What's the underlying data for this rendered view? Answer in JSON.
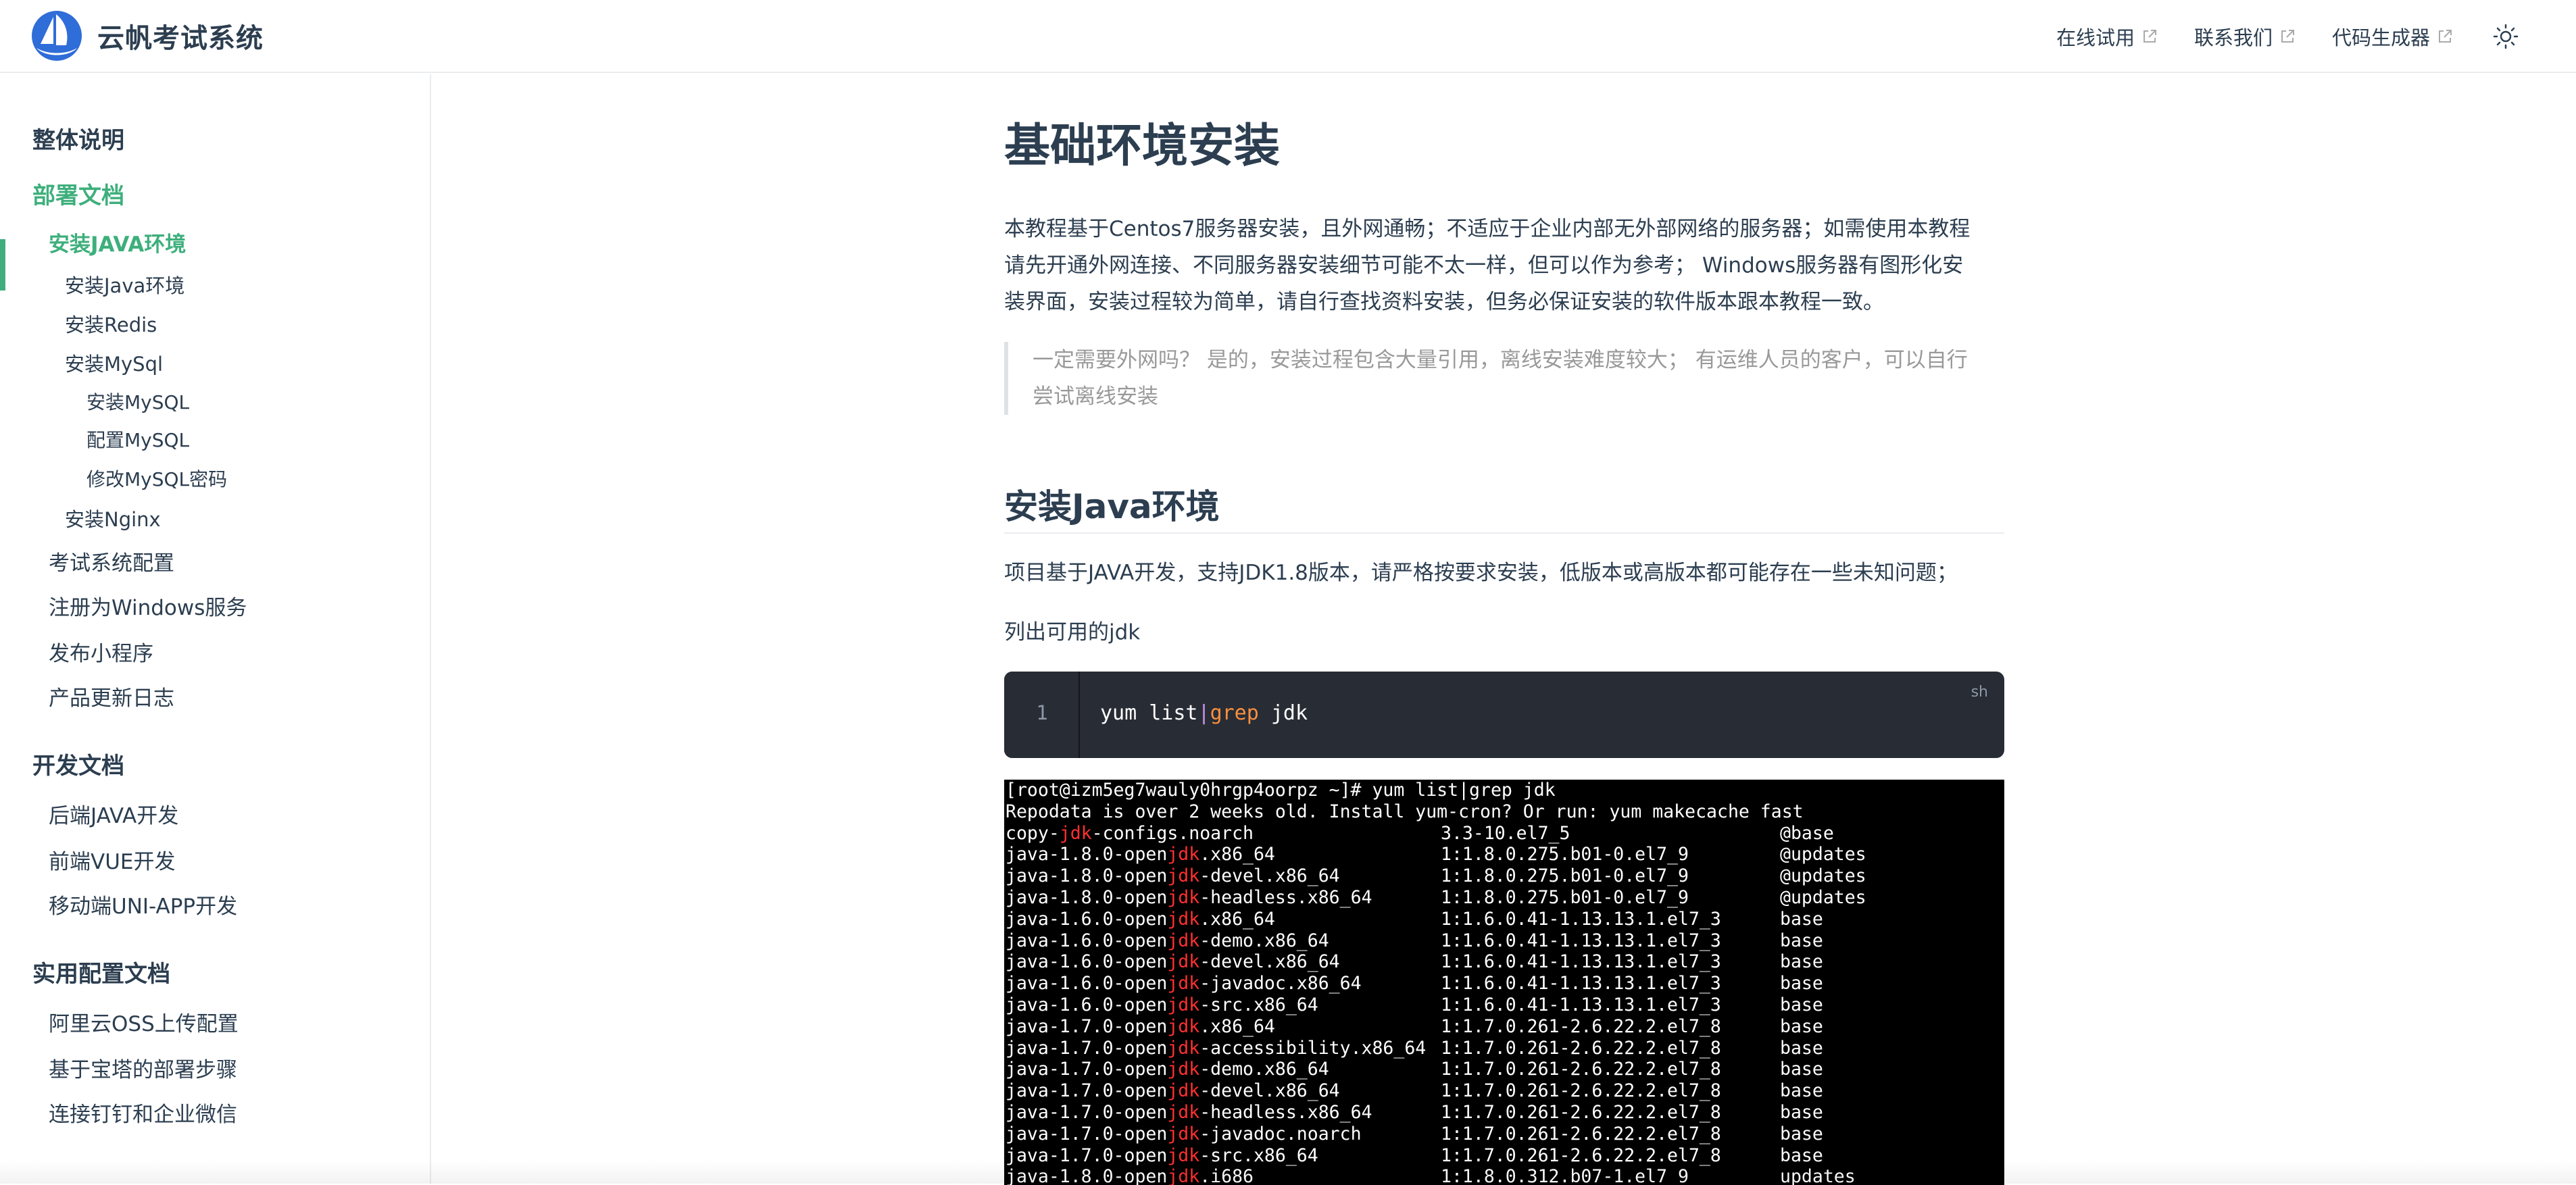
{
  "header": {
    "site_name": "云帆考试系统",
    "nav": [
      {
        "label": "在线试用"
      },
      {
        "label": "联系我们"
      },
      {
        "label": "代码生成器"
      }
    ]
  },
  "sidebar": {
    "items": [
      {
        "label": "整体说明",
        "level": 0
      },
      {
        "label": "部署文档",
        "level": 0,
        "active": true
      },
      {
        "label": "安装JAVA环境",
        "level": 1,
        "active": true
      },
      {
        "label": "安装Java环境",
        "level": 2
      },
      {
        "label": "安装Redis",
        "level": 2
      },
      {
        "label": "安装MySql",
        "level": 2
      },
      {
        "label": "安装MySQL",
        "level": 3
      },
      {
        "label": "配置MySQL",
        "level": 3
      },
      {
        "label": "修改MySQL密码",
        "level": 3
      },
      {
        "label": "安装Nginx",
        "level": 2
      },
      {
        "label": "考试系统配置",
        "level": 1
      },
      {
        "label": "注册为Windows服务",
        "level": 1
      },
      {
        "label": "发布小程序",
        "level": 1
      },
      {
        "label": "产品更新日志",
        "level": 1
      },
      {
        "label": "开发文档",
        "level": 0
      },
      {
        "label": "后端JAVA开发",
        "level": 1
      },
      {
        "label": "前端VUE开发",
        "level": 1
      },
      {
        "label": "移动端UNI-APP开发",
        "level": 1
      },
      {
        "label": "实用配置文档",
        "level": 0
      },
      {
        "label": "阿里云OSS上传配置",
        "level": 1
      },
      {
        "label": "基于宝塔的部署步骤",
        "level": 1
      },
      {
        "label": "连接钉钉和企业微信",
        "level": 1
      }
    ]
  },
  "content": {
    "title": "基础环境安装",
    "intro_lines": [
      "本教程基于Centos7服务器安装，且外网通畅；不适应于企业内部无外部网络的服务器；如需使用本教程",
      "请先开通外网连接、不同服务器安装细节可能不太一样，但可以作为参考； Windows服务器有图形化安",
      "装界面，安装过程较为简单，请自行查找资料安装，但务必保证安装的软件版本跟本教程一致。"
    ],
    "quote_lines": [
      "一定需要外网吗？ 是的，安装过程包含大量引用，离线安装难度较大； 有运维人员的客户，可以自行",
      "尝试离线安装"
    ],
    "h2": "安装Java环境",
    "para1": "项目基于JAVA开发，支持JDK1.8版本，请严格按要求安装，低版本或高版本都可能存在一些未知问题；",
    "para2": "列出可用的jdk",
    "code": {
      "line_number": "1",
      "cmd_a": "yum list",
      "cmd_pipe": "|",
      "cmd_grep": "grep",
      "cmd_b": " jdk",
      "lang": "sh"
    },
    "terminal": {
      "prompt_line": "[root@izm5eg7wauly0hrgp4oorpz ~]# yum list|grep jdk",
      "notice_line": "Repodata is over 2 weeks old. Install yum-cron? Or run: yum makecache fast",
      "rows": [
        {
          "pre": "copy-",
          "hl": "jdk",
          "post": "-configs.noarch",
          "ver": "3.3-10.el7_5",
          "repo": "@base"
        },
        {
          "pre": "java-1.8.0-open",
          "hl": "jdk",
          "post": ".x86_64",
          "ver": "1:1.8.0.275.b01-0.el7_9",
          "repo": "@updates"
        },
        {
          "pre": "java-1.8.0-open",
          "hl": "jdk",
          "post": "-devel.x86_64",
          "ver": "1:1.8.0.275.b01-0.el7_9",
          "repo": "@updates"
        },
        {
          "pre": "java-1.8.0-open",
          "hl": "jdk",
          "post": "-headless.x86_64",
          "ver": "1:1.8.0.275.b01-0.el7_9",
          "repo": "@updates"
        },
        {
          "pre": "java-1.6.0-open",
          "hl": "jdk",
          "post": ".x86_64",
          "ver": "1:1.6.0.41-1.13.13.1.el7_3",
          "repo": "base"
        },
        {
          "pre": "java-1.6.0-open",
          "hl": "jdk",
          "post": "-demo.x86_64",
          "ver": "1:1.6.0.41-1.13.13.1.el7_3",
          "repo": "base"
        },
        {
          "pre": "java-1.6.0-open",
          "hl": "jdk",
          "post": "-devel.x86_64",
          "ver": "1:1.6.0.41-1.13.13.1.el7_3",
          "repo": "base"
        },
        {
          "pre": "java-1.6.0-open",
          "hl": "jdk",
          "post": "-javadoc.x86_64",
          "ver": "1:1.6.0.41-1.13.13.1.el7_3",
          "repo": "base"
        },
        {
          "pre": "java-1.6.0-open",
          "hl": "jdk",
          "post": "-src.x86_64",
          "ver": "1:1.6.0.41-1.13.13.1.el7_3",
          "repo": "base"
        },
        {
          "pre": "java-1.7.0-open",
          "hl": "jdk",
          "post": ".x86_64",
          "ver": "1:1.7.0.261-2.6.22.2.el7_8",
          "repo": "base"
        },
        {
          "pre": "java-1.7.0-open",
          "hl": "jdk",
          "post": "-accessibility.x86_64",
          "ver": "1:1.7.0.261-2.6.22.2.el7_8",
          "repo": "base"
        },
        {
          "pre": "java-1.7.0-open",
          "hl": "jdk",
          "post": "-demo.x86_64",
          "ver": "1:1.7.0.261-2.6.22.2.el7_8",
          "repo": "base"
        },
        {
          "pre": "java-1.7.0-open",
          "hl": "jdk",
          "post": "-devel.x86_64",
          "ver": "1:1.7.0.261-2.6.22.2.el7_8",
          "repo": "base"
        },
        {
          "pre": "java-1.7.0-open",
          "hl": "jdk",
          "post": "-headless.x86_64",
          "ver": "1:1.7.0.261-2.6.22.2.el7_8",
          "repo": "base"
        },
        {
          "pre": "java-1.7.0-open",
          "hl": "jdk",
          "post": "-javadoc.noarch",
          "ver": "1:1.7.0.261-2.6.22.2.el7_8",
          "repo": "base"
        },
        {
          "pre": "java-1.7.0-open",
          "hl": "jdk",
          "post": "-src.x86_64",
          "ver": "1:1.7.0.261-2.6.22.2.el7_8",
          "repo": "base"
        },
        {
          "pre": "java-1.8.0-open",
          "hl": "jdk",
          "post": ".i686",
          "ver": "1:1.8.0.312.b07-1.el7_9",
          "repo": "updates"
        }
      ]
    }
  },
  "theme": {
    "accent": "#3eaf7c",
    "text": "#2c3e50",
    "muted": "#999999",
    "code_bg": "#282c34",
    "terminal_highlight": "#ff3030"
  }
}
